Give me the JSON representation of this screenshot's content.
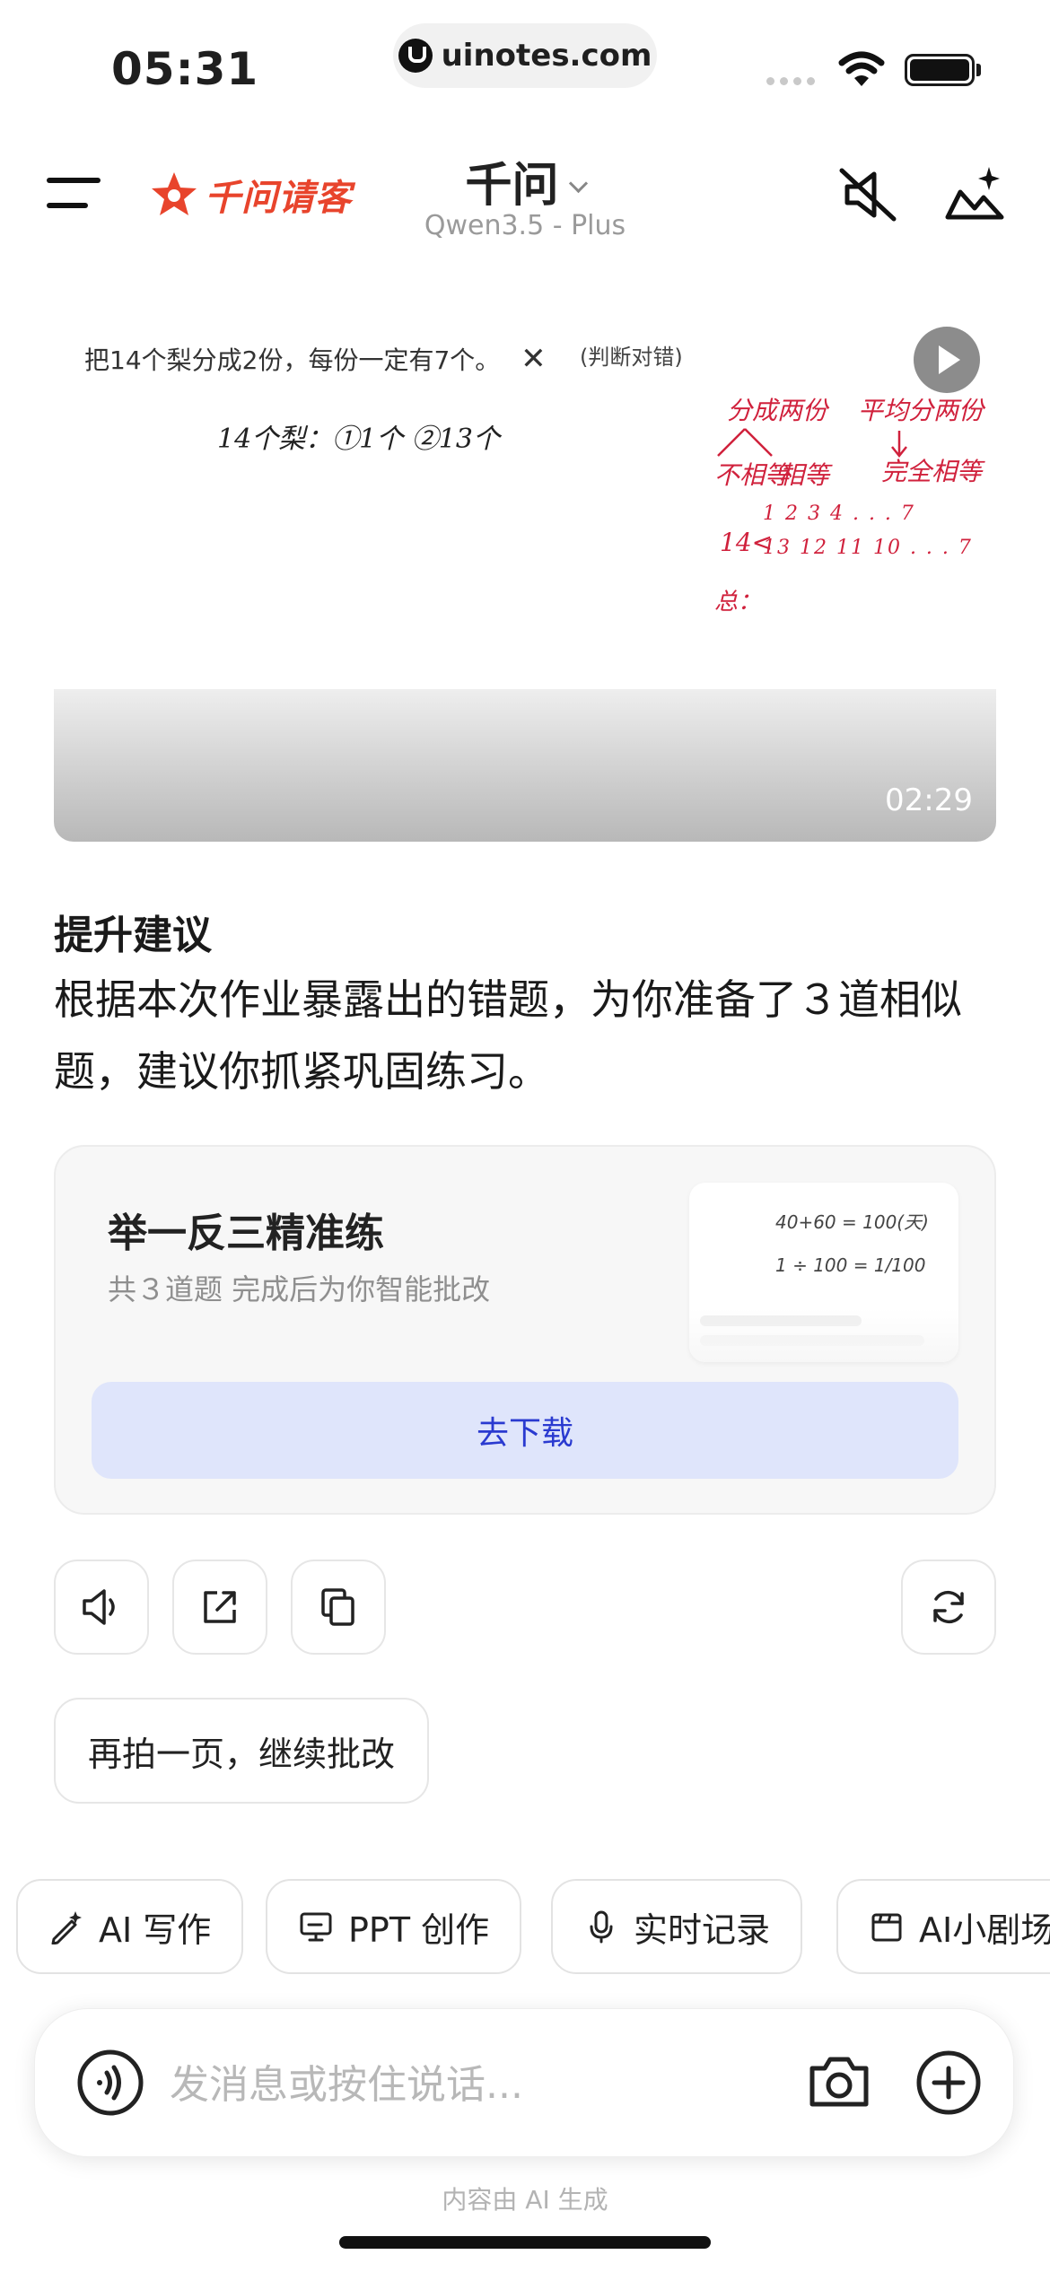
{
  "status_bar": {
    "time": "05:31",
    "url": "uinotes.com"
  },
  "header": {
    "brand": "千问请客",
    "title": "千问",
    "model": "Qwen3.5 - Plus"
  },
  "video": {
    "question": "把14个梨分成2份，每份一定有7个。",
    "question_mark": "✕",
    "tag": "(判断对错)",
    "duration": "02:29",
    "handwriting": [
      "14个梨：①1个 ②13个",
      "分成两份",
      "平均分两份",
      "不相等",
      "相等",
      "完全相等",
      "14<",
      "1  2  3  4 . . . 7",
      "13 12 11 10 . . . 7",
      "总："
    ]
  },
  "suggestion": {
    "heading": "提升建议",
    "body": "根据本次作业暴露出的错题，为你准备了３道相似题，建议你抓紧巩固练习。"
  },
  "practice_card": {
    "title": "举一反三精准练",
    "subtitle": "共３道题 完成后为你智能批改",
    "button": "去下载",
    "thumb_lines": [
      "40+60 = 100(天)",
      "1 ÷ 100 = 1/100"
    ]
  },
  "follow_up": "再拍一页，继续批改",
  "tools": [
    {
      "label": "AI 写作",
      "icon": "pen-sparkle-icon"
    },
    {
      "label": "PPT 创作",
      "icon": "presentation-icon"
    },
    {
      "label": "实时记录",
      "icon": "microphone-icon"
    },
    {
      "label": "AI小剧场",
      "icon": "theater-icon"
    }
  ],
  "input": {
    "placeholder": "发消息或按住说话..."
  },
  "footer": "内容由 AI 生成",
  "colors": {
    "brand": "#e8442c",
    "button_bg": "#dfe5fb",
    "button_text": "#2a3ad0",
    "handwriting_red": "#d0213c"
  }
}
